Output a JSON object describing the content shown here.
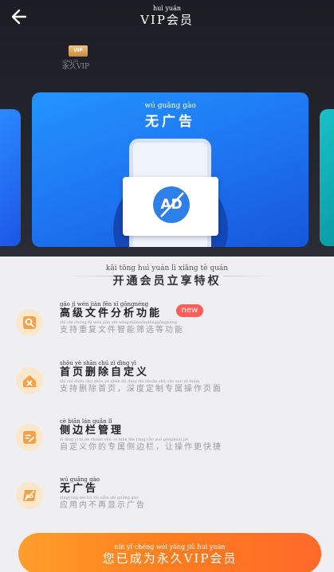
{
  "nav": {
    "title_pinyin": "huì yuán",
    "title": "VIP会员"
  },
  "status": {
    "badge_label": "VIP",
    "forever_pinyin": "yǒng jiǔ",
    "forever_label": "永久VIP"
  },
  "banner": {
    "pinyin": "wú guǎng gào",
    "title": "无广告",
    "icon_text": "AD"
  },
  "benefits": {
    "heading_pinyin": "kāi tōng huì yuán  lì  xiǎng  tè  quán",
    "heading": "开通会员立享特权",
    "items": [
      {
        "icon": "search-file-icon",
        "title_pinyin": "gāo    jí  wén jiàn  fēn   xī  gōngnéng",
        "title": "高级文件分析功能",
        "desc_pinyin": "zhī  chí chóng  fù  wén jiàn  zhì néngshāixuǎnděnggōngnéng",
        "desc": "支持重复文件智能筛选等功能",
        "badge": "new"
      },
      {
        "icon": "home-delete-icon",
        "title_pinyin": "shǒu yè  shān chú   zì  dìng   yì",
        "title": "首页删除自定义",
        "desc_pinyin": "zhī   chí shān chú shǒu yè       shēn  dù dìng  zhì  zhuān shǔ  cāo zuò   yè  miàn",
        "desc": "支持删除首页，深度定制专属操作页面"
      },
      {
        "icon": "edit-sidebar-icon",
        "title_pinyin": "cè  biān lán guǎn   lǐ",
        "title": "侧边栏管理",
        "desc_pinyin": "zì  dìng  yì   nǐ   de  zhuān shǔ  cè  biān lán       ràng cāo zuò gèngkuài  jié",
        "desc": "自定义你的专属侧边栏，让操作更快捷"
      },
      {
        "icon": "no-ad-icon",
        "title_pinyin": "wú guǎng gào",
        "title": "无广告",
        "desc_pinyin": "yìngyòng nèi   bú   zài xiǎn shì guǎng gào",
        "desc": "应用内不再显示广告"
      }
    ]
  },
  "cta": {
    "pinyin": "nín   yǐ  chéng wéi yǒng  jiǔ             huì yuán",
    "label": "您已成为永久VIP会员"
  },
  "colors": {
    "accent": "#ff8a25",
    "banner_blue": "#1d73f0",
    "header_bg": "#1c1d23",
    "badge_red": "#ff5d57"
  }
}
